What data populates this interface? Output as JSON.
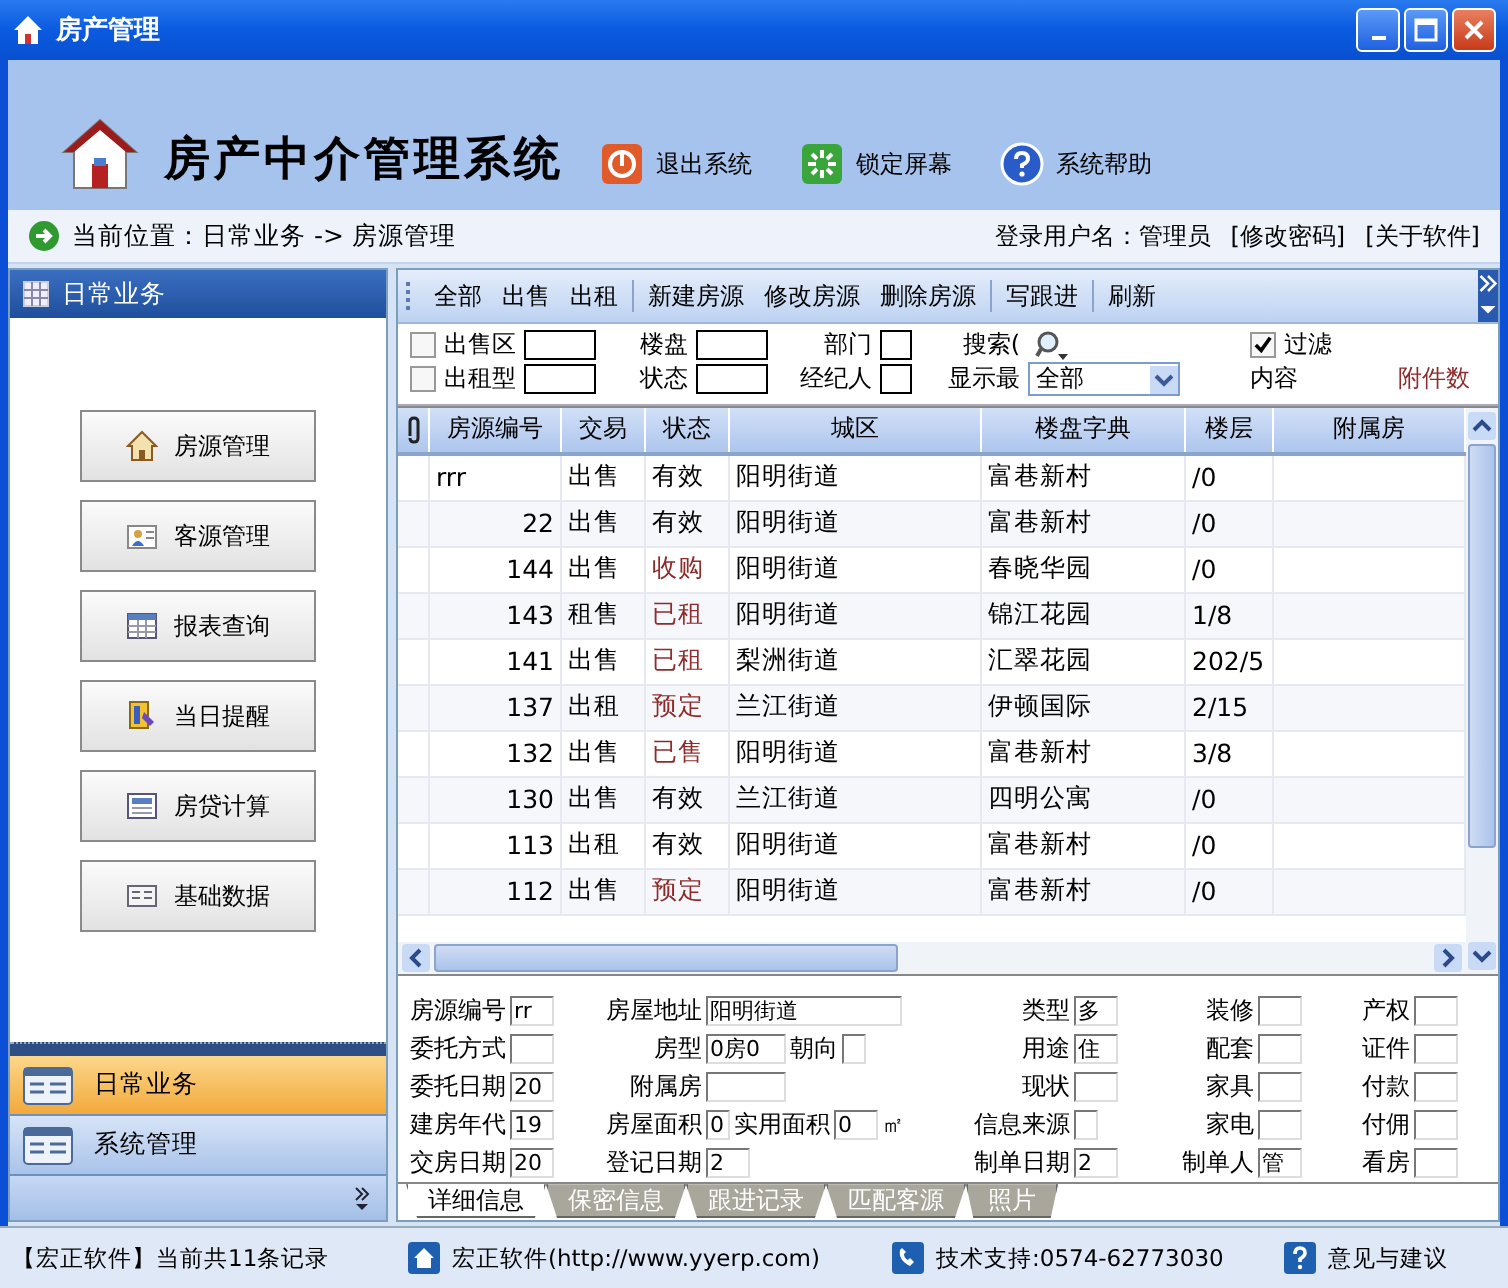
{
  "window": {
    "title": "房产管理"
  },
  "header": {
    "app_name": "房产中介管理系统",
    "actions": [
      {
        "label": "退出系统",
        "kind": "exit"
      },
      {
        "label": "锁定屏幕",
        "kind": "lock"
      },
      {
        "label": "系统帮助",
        "kind": "help"
      }
    ]
  },
  "location_bar": {
    "label": "当前位置：日常业务 -> 房源管理",
    "user": "登录用户名：管理员",
    "links": [
      "[修改密码]",
      "[关于软件]"
    ]
  },
  "sidebar": {
    "title": "日常业务",
    "items": [
      {
        "label": "房源管理",
        "kind": "house"
      },
      {
        "label": "客源管理",
        "kind": "person"
      },
      {
        "label": "报表查询",
        "kind": "table"
      },
      {
        "label": "当日提醒",
        "kind": "bell"
      },
      {
        "label": "房贷计算",
        "kind": "calc"
      },
      {
        "label": "基础数据",
        "kind": "data"
      }
    ],
    "sections": [
      {
        "label": "日常业务",
        "selected": true
      },
      {
        "label": "系统管理",
        "selected": false
      }
    ]
  },
  "toolbar": {
    "groups": [
      [
        "全部",
        "出售",
        "出租"
      ],
      [
        "新建房源",
        "修改房源",
        "删除房源"
      ],
      [
        "写跟进"
      ],
      [
        "刷新"
      ]
    ]
  },
  "filters": {
    "sale_area": {
      "label": "出售区",
      "checked": false
    },
    "rent_type": {
      "label": "出租型",
      "checked": false
    },
    "building": "楼盘",
    "status": "状态",
    "department": "部门",
    "agent": "经纪人",
    "search": "搜索(",
    "display": {
      "label": "显示最",
      "value": "全部"
    },
    "filter": {
      "label": "过滤",
      "checked": true
    },
    "content": "内容",
    "attachments": "附件数"
  },
  "table": {
    "columns": [
      "房源编号",
      "交易",
      "状态",
      "城区",
      "楼盘字典",
      "楼层",
      "附属房"
    ],
    "rows": [
      {
        "code": "rrr",
        "deal": "出售",
        "status": "有效",
        "color": "#000000",
        "district": "阳明街道",
        "estate": "富巷新村",
        "floor": "/0"
      },
      {
        "code": "22",
        "deal": "出售",
        "status": "有效",
        "color": "#000000",
        "district": "阳明街道",
        "estate": "富巷新村",
        "floor": "/0"
      },
      {
        "code": "144",
        "deal": "出售",
        "status": "收购",
        "color": "#8e2b2b",
        "district": "阳明街道",
        "estate": "春晓华园",
        "floor": "/0"
      },
      {
        "code": "143",
        "deal": "租售",
        "status": "已租",
        "color": "#8e2b2b",
        "district": "阳明街道",
        "estate": "锦江花园",
        "floor": "1/8"
      },
      {
        "code": "141",
        "deal": "出售",
        "status": "已租",
        "color": "#8e2b2b",
        "district": "梨洲街道",
        "estate": "汇翠花园",
        "floor": "202/5"
      },
      {
        "code": "137",
        "deal": "出租",
        "status": "预定",
        "color": "#8e2b2b",
        "district": "兰江街道",
        "estate": "伊顿国际",
        "floor": "2/15"
      },
      {
        "code": "132",
        "deal": "出售",
        "status": "已售",
        "color": "#8e2b2b",
        "district": "阳明街道",
        "estate": "富巷新村",
        "floor": "3/8"
      },
      {
        "code": "130",
        "deal": "出售",
        "status": "有效",
        "color": "#000000",
        "district": "兰江街道",
        "estate": "四明公寓",
        "floor": "/0"
      },
      {
        "code": "113",
        "deal": "出租",
        "status": "有效",
        "color": "#000000",
        "district": "阳明街道",
        "estate": "富巷新村",
        "floor": "/0"
      },
      {
        "code": "112",
        "deal": "出售",
        "status": "预定",
        "color": "#8e2b2b",
        "district": "阳明街道",
        "estate": "富巷新村",
        "floor": "/0"
      }
    ]
  },
  "details": {
    "columns": [
      [
        [
          {
            "label": "房源编号",
            "value": "rr",
            "kind": "short"
          }
        ],
        [
          {
            "label": "委托方式",
            "kind": "short"
          }
        ],
        [
          {
            "label": "委托日期",
            "value": "20",
            "kind": "short"
          }
        ],
        [
          {
            "label": "建房年代",
            "value": "19",
            "kind": "short"
          }
        ],
        [
          {
            "label": "交房日期",
            "value": "20",
            "kind": "short"
          }
        ]
      ],
      [
        [
          {
            "label": "房屋地址",
            "value": "阳明街道",
            "kind": "wide"
          }
        ],
        [
          {
            "label": "房型",
            "value": "0房0",
            "kind": "medium"
          },
          {
            "label": "朝向",
            "kind": "tiny"
          }
        ],
        [
          {
            "label": "附属房",
            "kind": "medium"
          }
        ],
        [
          {
            "label": "房屋面积",
            "value": "0",
            "kind": "tiny"
          },
          {
            "label": "实用面积",
            "value": "0",
            "kind": "short",
            "unit": "㎡"
          }
        ],
        [
          {
            "label": "登记日期",
            "value": "2",
            "kind": "short"
          }
        ]
      ],
      [
        [
          {
            "label": "类型",
            "value": "多",
            "kind": "short"
          }
        ],
        [
          {
            "label": "用途",
            "value": "住",
            "kind": "short"
          }
        ],
        [
          {
            "label": "现状",
            "kind": "short"
          }
        ],
        [
          {
            "label": "信息来源",
            "kind": "tiny"
          }
        ],
        [
          {
            "label": "制单日期",
            "value": "2",
            "kind": "short"
          }
        ]
      ],
      [
        [
          {
            "label": "装修",
            "kind": "short"
          }
        ],
        [
          {
            "label": "配套",
            "kind": "short"
          }
        ],
        [
          {
            "label": "家具",
            "kind": "short"
          }
        ],
        [
          {
            "label": "家电",
            "kind": "short"
          }
        ],
        [
          {
            "label": "制单人",
            "value": "管",
            "kind": "short"
          }
        ]
      ],
      [
        [
          {
            "label": "产权",
            "kind": "short"
          }
        ],
        [
          {
            "label": "证件",
            "kind": "short"
          }
        ],
        [
          {
            "label": "付款",
            "kind": "short"
          }
        ],
        [
          {
            "label": "付佣",
            "kind": "short"
          }
        ],
        [
          {
            "label": "看房",
            "kind": "short"
          }
        ]
      ]
    ]
  },
  "detail_tabs": [
    {
      "label": "详细信息",
      "selected": true
    },
    {
      "label": "保密信息",
      "selected": false
    },
    {
      "label": "跟进记录",
      "selected": false
    },
    {
      "label": "匹配客源",
      "selected": false
    },
    {
      "label": "照片",
      "selected": false
    }
  ],
  "status_bar": {
    "records": "【宏正软件】当前共11条记录",
    "items": [
      {
        "label": "宏正软件(http://www.yyerp.com)",
        "kind": "home"
      },
      {
        "label": "技术支持:0574-62773030",
        "kind": "phone"
      },
      {
        "label": "意见与建议",
        "kind": "help"
      }
    ]
  }
}
